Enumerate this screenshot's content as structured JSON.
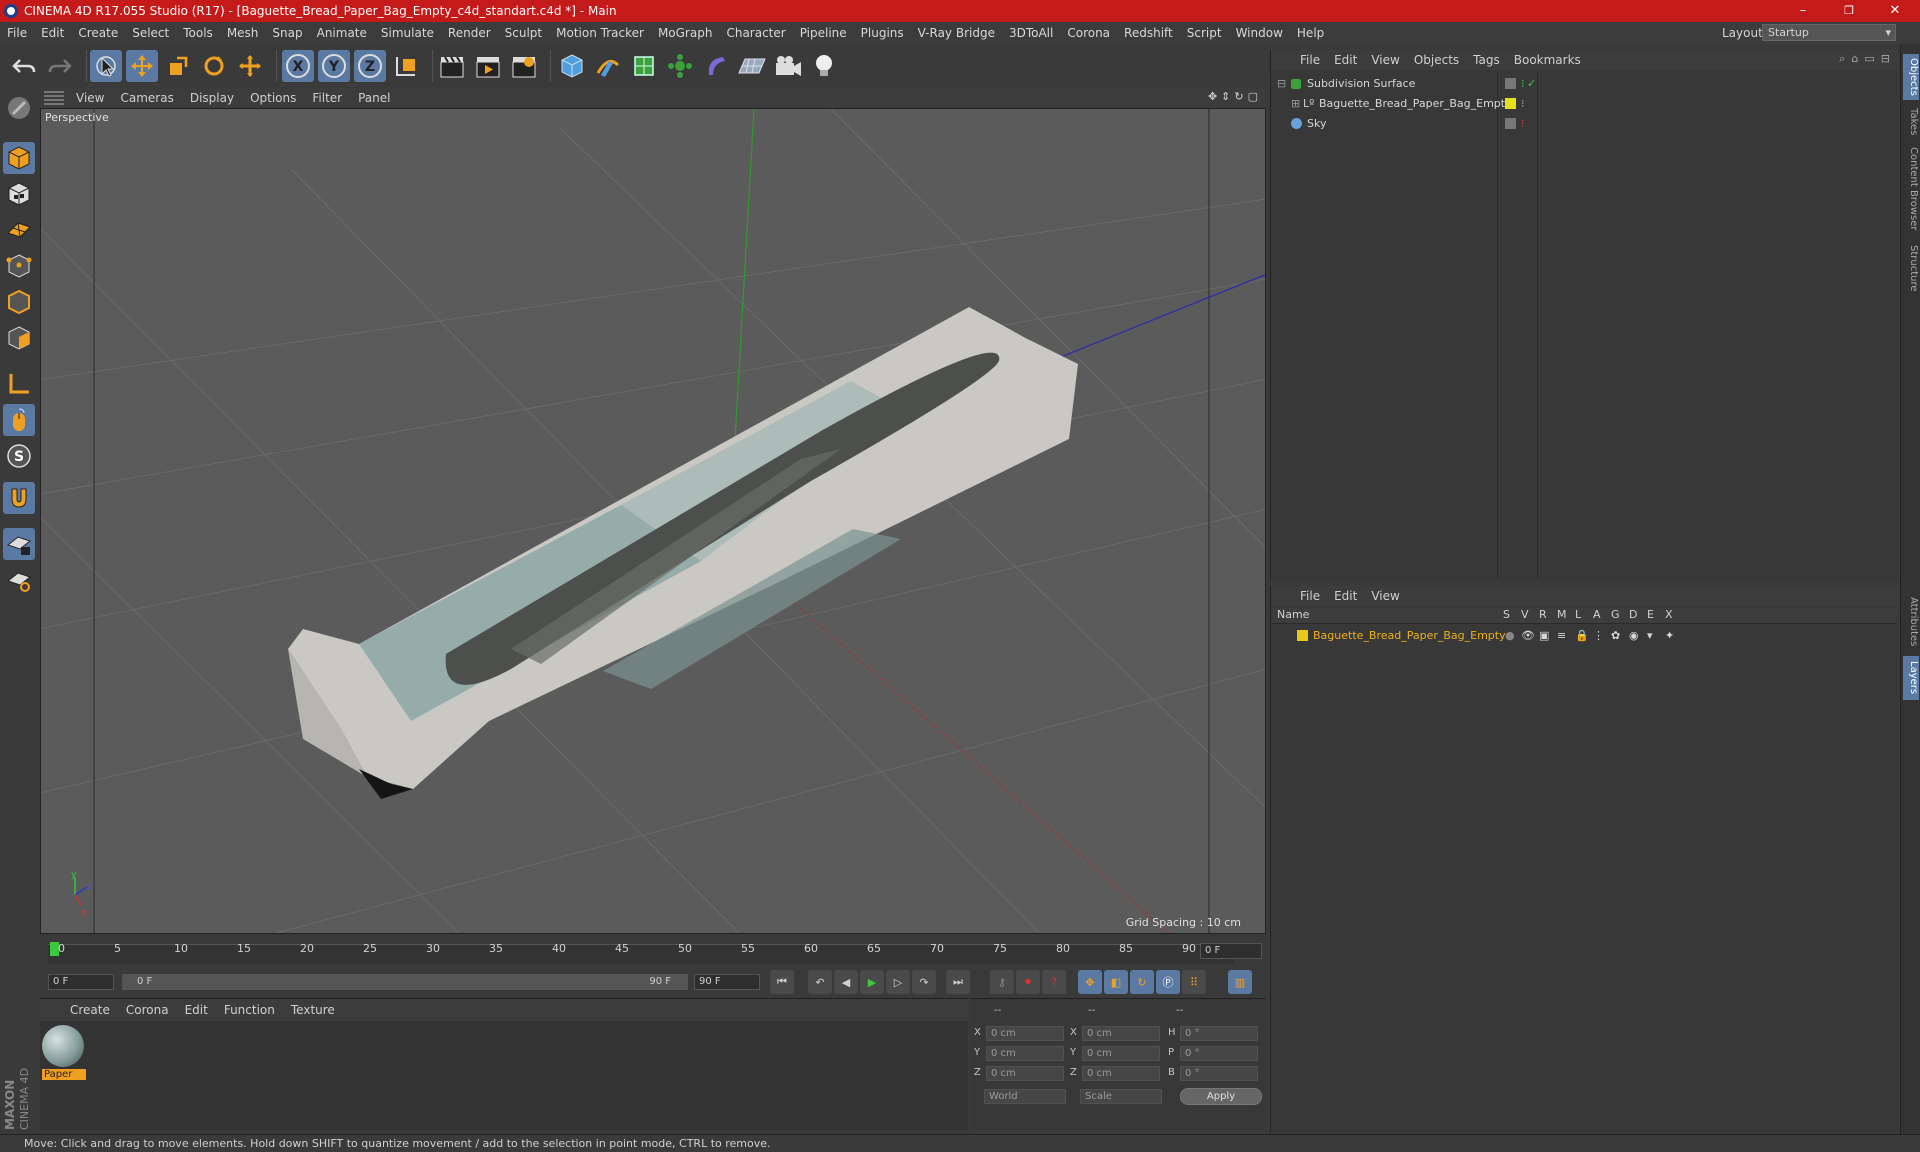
{
  "window": {
    "title": "CINEMA 4D R17.055 Studio (R17) - [Baguette_Bread_Paper_Bag_Empty_c4d_standart.c4d *] - Main",
    "minimize": "–",
    "maximize": "❐",
    "close": "✕"
  },
  "menubar": {
    "items": [
      "File",
      "Edit",
      "Create",
      "Select",
      "Tools",
      "Mesh",
      "Snap",
      "Animate",
      "Simulate",
      "Render",
      "Sculpt",
      "Motion Tracker",
      "MoGraph",
      "Character",
      "Pipeline",
      "Plugins",
      "V-Ray Bridge",
      "3DToAll",
      "Corona",
      "Redshift",
      "Script",
      "Window",
      "Help"
    ],
    "layout_label": "Layout:",
    "layout_value": "Startup"
  },
  "viewport": {
    "menu": [
      "View",
      "Cameras",
      "Display",
      "Options",
      "Filter",
      "Panel"
    ],
    "label": "Perspective",
    "grid_spacing": "Grid Spacing : 10 cm"
  },
  "timeline": {
    "ticks": [
      "0",
      "5",
      "10",
      "15",
      "20",
      "25",
      "30",
      "35",
      "40",
      "45",
      "50",
      "55",
      "60",
      "65",
      "70",
      "75",
      "80",
      "85",
      "90"
    ],
    "current_frame": "0 F",
    "start_field": "0 F",
    "range_start": "0 F",
    "range_end": "90 F",
    "end_field": "90 F"
  },
  "materials": {
    "menu": [
      "Create",
      "Corona",
      "Edit",
      "Function",
      "Texture"
    ],
    "items": [
      {
        "name": "Paper"
      }
    ]
  },
  "coordinates": {
    "header": [
      "--",
      "--",
      "--"
    ],
    "rows": [
      {
        "l1": "X",
        "v1": "0 cm",
        "l2": "X",
        "v2": "0 cm",
        "l3": "H",
        "v3": "0 °"
      },
      {
        "l1": "Y",
        "v1": "0 cm",
        "l2": "Y",
        "v2": "0 cm",
        "l3": "P",
        "v3": "0 °"
      },
      {
        "l1": "Z",
        "v1": "0 cm",
        "l2": "Z",
        "v2": "0 cm",
        "l3": "B",
        "v3": "0 °"
      }
    ],
    "mode1": "World",
    "mode2": "Scale",
    "apply": "Apply"
  },
  "object_manager": {
    "menu": [
      "File",
      "Edit",
      "View",
      "Objects",
      "Tags",
      "Bookmarks"
    ],
    "objects": [
      {
        "name": "Subdivision Surface"
      },
      {
        "name": "Baguette_Bread_Paper_Bag_Empty"
      },
      {
        "name": "Sky"
      }
    ]
  },
  "layer_manager": {
    "menu": [
      "File",
      "Edit",
      "View"
    ],
    "columns": [
      "Name",
      "S",
      "V",
      "R",
      "M",
      "L",
      "A",
      "G",
      "D",
      "E",
      "X"
    ],
    "layers": [
      {
        "name": "Baguette_Bread_Paper_Bag_Empty",
        "color": "#e8c81a"
      }
    ]
  },
  "right_tabs": [
    "Objects",
    "Takes",
    "Content Browser",
    "Structure",
    "Attributes",
    "Layers"
  ],
  "status": "Move: Click and drag to move elements. Hold down SHIFT to quantize movement / add to the selection in point mode, CTRL to remove.",
  "branding": {
    "logo_text_1": "MAXON",
    "logo_text_2": "CINEMA 4D"
  },
  "colors": {
    "accent": "#5b7aa3",
    "title_bar": "#c41a1a",
    "tool_orange": "#f0a020",
    "layer_name": "#f0b020"
  }
}
